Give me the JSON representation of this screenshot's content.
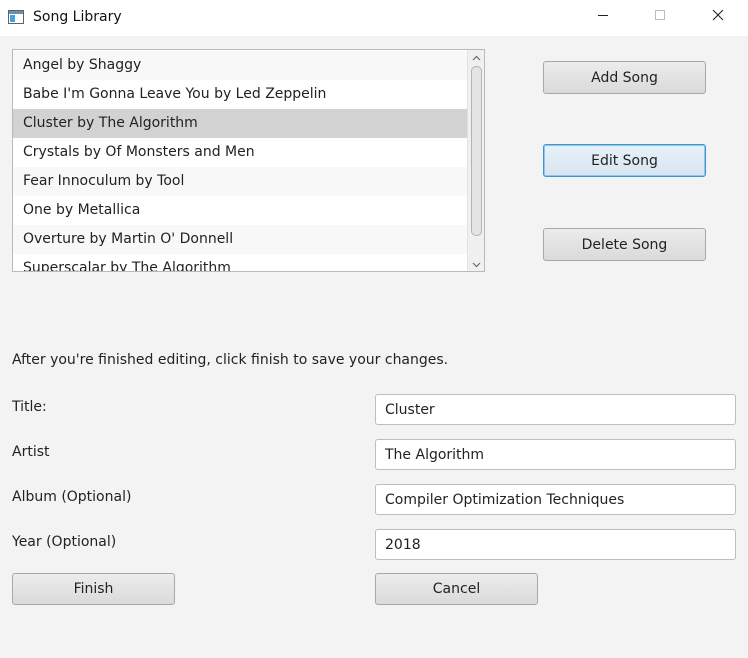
{
  "window": {
    "title": "Song Library",
    "icon": "app-window-icon",
    "controls": [
      "minimize-icon",
      "maximize-icon",
      "close-icon"
    ]
  },
  "song_list": {
    "items": [
      {
        "label": "Angel by Shaggy",
        "selected": false
      },
      {
        "label": "Babe I'm Gonna Leave You by Led Zeppelin",
        "selected": false
      },
      {
        "label": "Cluster by The Algorithm",
        "selected": true
      },
      {
        "label": "Crystals by Of Monsters and Men",
        "selected": false
      },
      {
        "label": "Fear Innoculum by Tool",
        "selected": false
      },
      {
        "label": "One by Metallica",
        "selected": false
      },
      {
        "label": "Overture by Martin O' Donnell",
        "selected": false
      },
      {
        "label": "Superscalar by The Algorithm",
        "selected": false
      }
    ]
  },
  "actions": {
    "add_label": "Add Song",
    "edit_label": "Edit Song",
    "delete_label": "Delete Song"
  },
  "form": {
    "instruction": "After you're finished editing, click finish to save your changes.",
    "title_label": "Title:",
    "title_value": "Cluster",
    "artist_label": "Artist",
    "artist_value": "The Algorithm",
    "album_label": "Album (Optional)",
    "album_value": "Compiler Optimization Techniques",
    "year_label": "Year (Optional)",
    "year_value": "2018",
    "finish_label": "Finish",
    "cancel_label": "Cancel"
  },
  "colors": {
    "window_bg": "#f3f3f3",
    "selected_row": "#d2d2d2",
    "focus_border": "#3c97d1"
  }
}
